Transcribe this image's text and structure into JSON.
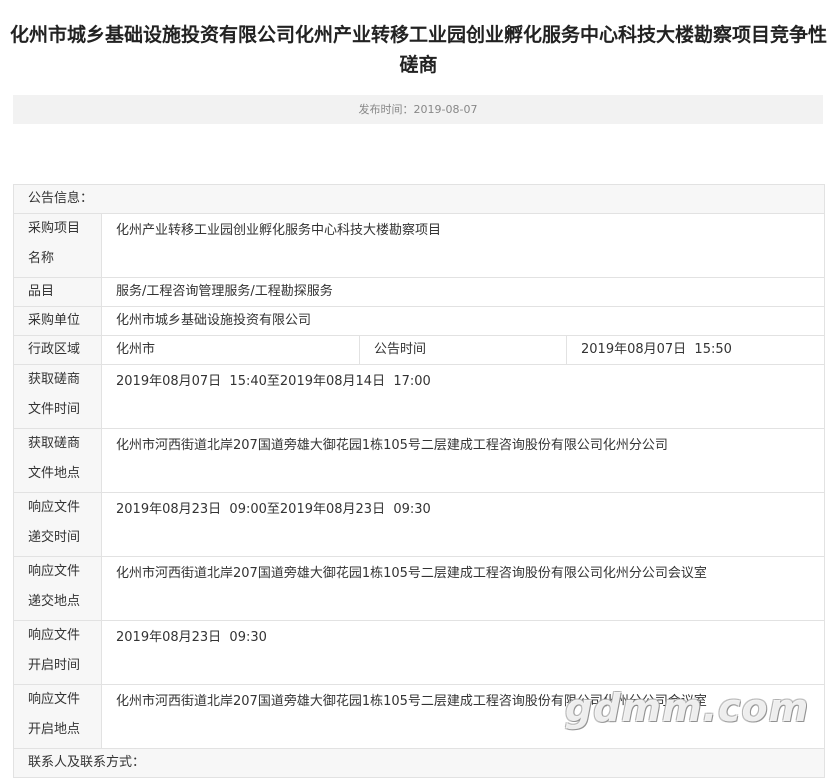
{
  "title": "化州市城乡基础设施投资有限公司化州产业转移工业园创业孵化服务中心科技大楼勘察项目竞争性磋商",
  "publish": {
    "label": "发布时间：",
    "date": "2019-08-07"
  },
  "table": {
    "section_notice": "公告信息：",
    "rows": {
      "project_name": {
        "label": "采购项目名称",
        "value": "化州产业转移工业园创业孵化服务中心科技大楼勘察项目"
      },
      "category": {
        "label": "品目",
        "value": "服务/工程咨询管理服务/工程勘探服务"
      },
      "purchaser": {
        "label": "采购单位",
        "value": "化州市城乡基础设施投资有限公司"
      },
      "region": {
        "label": "行政区域",
        "value": "化州市",
        "announce_label": "公告时间",
        "announce_value": "2019年08月07日  15:50"
      },
      "doc_time": {
        "label": "获取磋商文件时间",
        "value": "2019年08月07日  15:40至2019年08月14日  17:00"
      },
      "doc_place": {
        "label": "获取磋商文件地点",
        "value": "化州市河西街道北岸207国道旁雄大御花园1栋105号二层建成工程咨询股份有限公司化州分公司"
      },
      "submit_time": {
        "label": "响应文件递交时间",
        "value": "2019年08月23日  09:00至2019年08月23日  09:30"
      },
      "submit_place": {
        "label": "响应文件递交地点",
        "value": "化州市河西街道北岸207国道旁雄大御花园1栋105号二层建成工程咨询股份有限公司化州分公司会议室"
      },
      "open_time": {
        "label": "响应文件开启时间",
        "value": "2019年08月23日  09:30"
      },
      "open_place": {
        "label": "响应文件开启地点",
        "value": "化州市河西街道北岸207国道旁雄大御花园1栋105号二层建成工程咨询股份有限公司化州分公司会议室"
      }
    },
    "section_contact": "联系人及联系方式："
  },
  "watermark": "gdmm.com"
}
